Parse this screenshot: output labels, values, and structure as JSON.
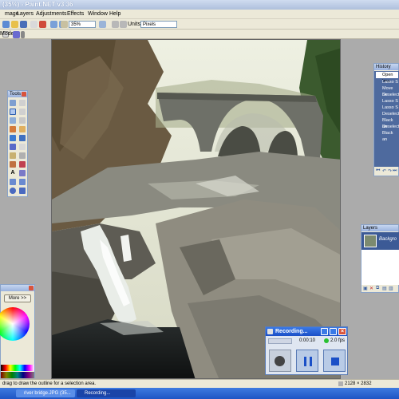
{
  "window": {
    "title": "(35%) - Paint.NET v3.36"
  },
  "menu": {
    "items": [
      "mage",
      "Layers",
      "Adjustments",
      "Effects",
      "Window",
      "Help"
    ]
  },
  "toolbar": {
    "zoom": "35%",
    "units_label": "Units:",
    "units_value": "Pixels",
    "mode_label": "Mode:"
  },
  "tools_panel": {
    "title": "Tools"
  },
  "history_panel": {
    "title": "History",
    "items": [
      "Open Ima",
      "Lasso S",
      "Move Se",
      "Deselect",
      "Lasso S",
      "Lasso S",
      "Deselect",
      "Black an",
      "Deselect",
      "Black an"
    ]
  },
  "layers_panel": {
    "title": "Layers",
    "layer_name": "Backgro"
  },
  "colors_panel": {
    "more_button": "More >>"
  },
  "recording": {
    "title": "Recording...",
    "time": "0:00:10",
    "fps": "2.0 fps"
  },
  "status": {
    "hint": "drag to draw the outline for a selection area.",
    "dimensions": "2128 × 2832"
  },
  "taskbar": {
    "items": [
      "river bridge.JPG (35...",
      "Recording..."
    ]
  }
}
